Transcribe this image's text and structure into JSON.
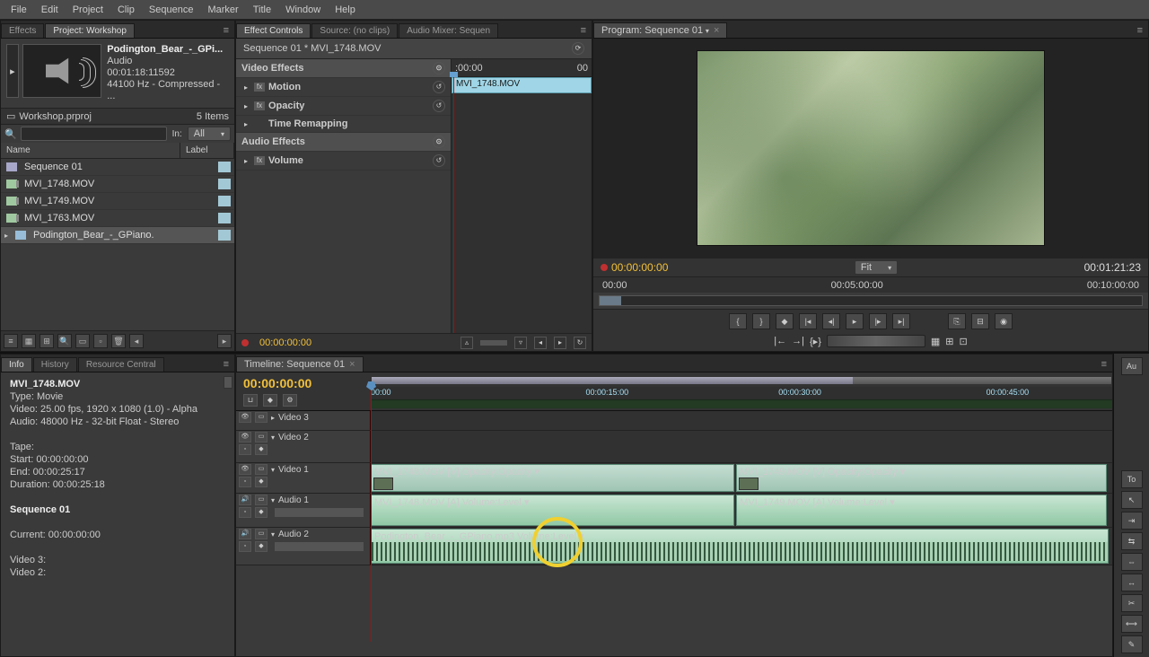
{
  "menu": {
    "items": [
      "File",
      "Edit",
      "Project",
      "Clip",
      "Sequence",
      "Marker",
      "Title",
      "Window",
      "Help"
    ]
  },
  "project_panel": {
    "tabs": {
      "effects": "Effects",
      "project": "Project: Workshop"
    },
    "clip_meta": {
      "name": "Podington_Bear_-_GPi...",
      "type": "Audio",
      "timecode": "00:01:18:11592",
      "format": "44100 Hz - Compressed - ..."
    },
    "bin_file": "Workshop.prproj",
    "item_count": "5 Items",
    "in_label": "In:",
    "in_value": "All",
    "cols": {
      "name": "Name",
      "label": "Label"
    },
    "items": [
      {
        "name": "Sequence 01",
        "icon": "sequence"
      },
      {
        "name": "MVI_1748.MOV",
        "icon": "movie"
      },
      {
        "name": "MVI_1749.MOV",
        "icon": "movie"
      },
      {
        "name": "MVI_1763.MOV",
        "icon": "movie"
      },
      {
        "name": "Podington_Bear_-_GPiano.",
        "icon": "audio"
      }
    ]
  },
  "effect_controls": {
    "tabs": {
      "ec": "Effect Controls",
      "source": "Source: (no clips)",
      "mixer": "Audio Mixer: Sequen"
    },
    "header": "Sequence 01 * MVI_1748.MOV",
    "sections": {
      "video": "Video Effects",
      "motion": "Motion",
      "opacity": "Opacity",
      "time": "Time Remapping",
      "audio": "Audio Effects",
      "volume": "Volume"
    },
    "ruler": {
      "start": ":00:00",
      "end": "00"
    },
    "clip_bar": "MVI_1748.MOV",
    "footer_tc": "00:00:00:00"
  },
  "program": {
    "tab": "Program: Sequence 01",
    "tc": "00:00:00:00",
    "fit": "Fit",
    "duration": "00:01:21:23",
    "ruler": [
      "00:00",
      "00:05:00:00",
      "00:10:00:00"
    ]
  },
  "info_panel": {
    "tabs": {
      "info": "Info",
      "history": "History",
      "resource": "Resource Central"
    },
    "clip_name": "MVI_1748.MOV",
    "type": "Type: Movie",
    "video": "Video: 25.00 fps, 1920 x 1080 (1.0) - Alpha",
    "audio": "Audio: 48000 Hz - 32-bit Float - Stereo",
    "tape": "Tape:",
    "start": "Start: 00:00:00:00",
    "end": "End: 00:00:25:17",
    "duration": "Duration: 00:00:25:18",
    "seq_name": "Sequence 01",
    "current": "Current: 00:00:00:00",
    "v3": "Video 3:",
    "v2": "Video 2:"
  },
  "timeline": {
    "tab": "Timeline: Sequence 01",
    "tc": "00:00:00:00",
    "ruler": [
      "00:00",
      "00:00:15:00",
      "00:00:30:00",
      "00:00:45:00"
    ],
    "tracks": {
      "v3": "Video 3",
      "v2": "Video 2",
      "v1": "Video 1",
      "a1": "Audio 1",
      "a2": "Audio 2"
    },
    "clips": {
      "v1a": "MVI_1748.MOV [V] Opacity:Opacity ▾",
      "v1b": "MVI_1749.MOV [V] Opacity:Opacity ▾",
      "a1a": "MVI_1748.MOV [A] Volume:Level ▾",
      "a1b": "MVI_1749.MOV [A] Volume:Level ▾",
      "a2": "Podington_Bear_-_GPiano.mp3 Volume:Level ▾"
    }
  },
  "side": {
    "au": "Au",
    "to": "To"
  },
  "search_placeholder": ""
}
